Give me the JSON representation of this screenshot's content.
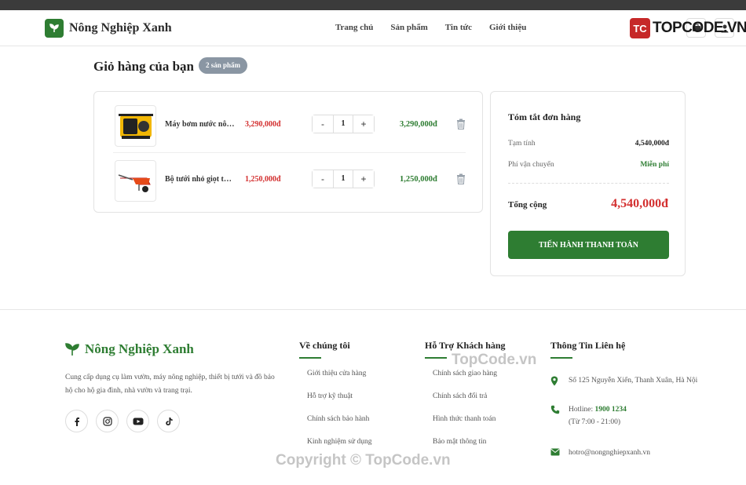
{
  "header": {
    "brand": "Nông Nghiệp Xanh",
    "nav": [
      "Trang chủ",
      "Sản phẩm",
      "Tin tức",
      "Giới thiệu"
    ],
    "watermark_badge": "TC",
    "watermark_text": "TOPCODE.VN",
    "icons": [
      "cart-icon",
      "user-icon"
    ]
  },
  "cart": {
    "title": "Giỏ hàng của bạn",
    "badge": "2 sản phẩm",
    "items": [
      {
        "name": "Máy bơm nước nông nghiệp",
        "price": "3,290,000đ",
        "qty": "1",
        "total": "3,290,000đ",
        "minus": "-",
        "plus": "+"
      },
      {
        "name": "Bộ tưới nhỏ giọt tự động",
        "price": "1,250,000đ",
        "qty": "1",
        "total": "1,250,000đ",
        "minus": "-",
        "plus": "+"
      }
    ]
  },
  "summary": {
    "title": "Tóm tắt đơn hàng",
    "subtotal_label": "Tạm tính",
    "subtotal_value": "4,540,000đ",
    "shipping_label": "Phí vận chuyển",
    "shipping_value": "Miễn phí",
    "total_label": "Tổng cộng",
    "total_value": "4,540,000đ",
    "checkout": "TIẾN HÀNH THANH TOÁN"
  },
  "footer": {
    "brand": "Nông Nghiệp Xanh",
    "description": "Cung cấp dụng cụ làm vườn, máy nông nghiệp, thiết bị tưới và đồ bảo hộ cho hộ gia đình, nhà vườn và trang trại.",
    "socials": [
      "facebook-icon",
      "instagram-icon",
      "youtube-icon",
      "tiktok-icon"
    ],
    "about": {
      "title": "Về chúng tôi",
      "links": [
        "Giới thiệu cửa hàng",
        "Hỗ trợ kỹ thuật",
        "Chính sách bảo hành",
        "Kinh nghiệm sử dụng"
      ]
    },
    "support": {
      "title": "Hỗ Trợ Khách hàng",
      "links": [
        "Chính sách giao hàng",
        "Chính sách đổi trả",
        "Hình thức thanh toán",
        "Bảo mật thông tin"
      ]
    },
    "contact": {
      "title": "Thông Tin Liên hệ",
      "address": "Số 125 Nguyễn Xiển, Thanh Xuân, Hà Nội",
      "hotline_label": "Hotline:",
      "hotline": "1900 1234",
      "hours": "(Từ 7:00 - 21:00)",
      "email": "hotro@nongnghiepxanh.vn"
    }
  },
  "watermarks": [
    "TopCode.vn",
    "Copyright © TopCode.vn"
  ],
  "colors": {
    "primary": "#2e7d32",
    "price": "#d32f2f",
    "badge": "#8a96a3"
  }
}
